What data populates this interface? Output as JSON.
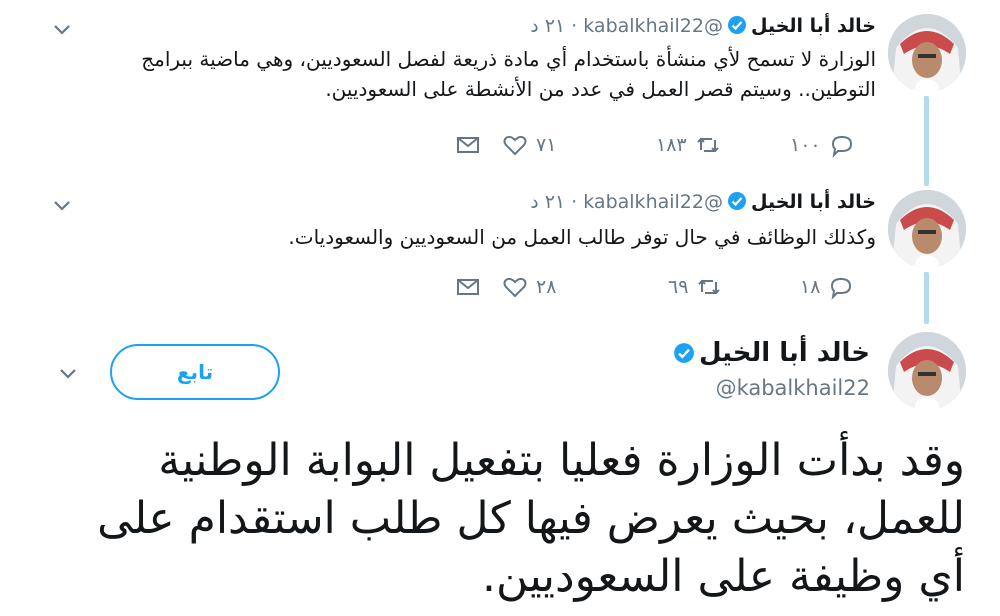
{
  "tweets": [
    {
      "name": "خالد أبا الخيل",
      "handle": "@kabalkhail22",
      "time": "٢١ د",
      "text": "الوزارة لا تسمح لأي منشأة باستخدام أي مادة ذريعة لفصل السعوديين، وهي ماضية ببرامج التوطين.. وسيتم قصر العمل في عدد من الأنشطة على السعوديين.",
      "replies": "١٠٠",
      "retweets": "١٨٣",
      "likes": "٧١"
    },
    {
      "name": "خالد أبا الخيل",
      "handle": "@kabalkhail22",
      "time": "٢١ د",
      "text": "وكذلك الوظائف في حال توفر طالب العمل من السعوديين والسعوديات.",
      "replies": "١٨",
      "retweets": "٦٩",
      "likes": "٢٨"
    }
  ],
  "main_tweet": {
    "name": "خالد أبا الخيل",
    "handle": "@kabalkhail22",
    "follow_label": "تابع",
    "text": "وقد بدأت الوزارة فعليا بتفعيل البوابة الوطنية للعمل، بحيث يعرض فيها كل طلب استقدام على أي وظيفة على السعوديين."
  },
  "colors": {
    "accent": "#1da1f2",
    "muted": "#657786",
    "thread_line": "#b3dbe8"
  },
  "icons": [
    "chevron-down-icon",
    "verified-badge-icon",
    "reply-icon",
    "retweet-icon",
    "like-icon",
    "message-icon"
  ]
}
